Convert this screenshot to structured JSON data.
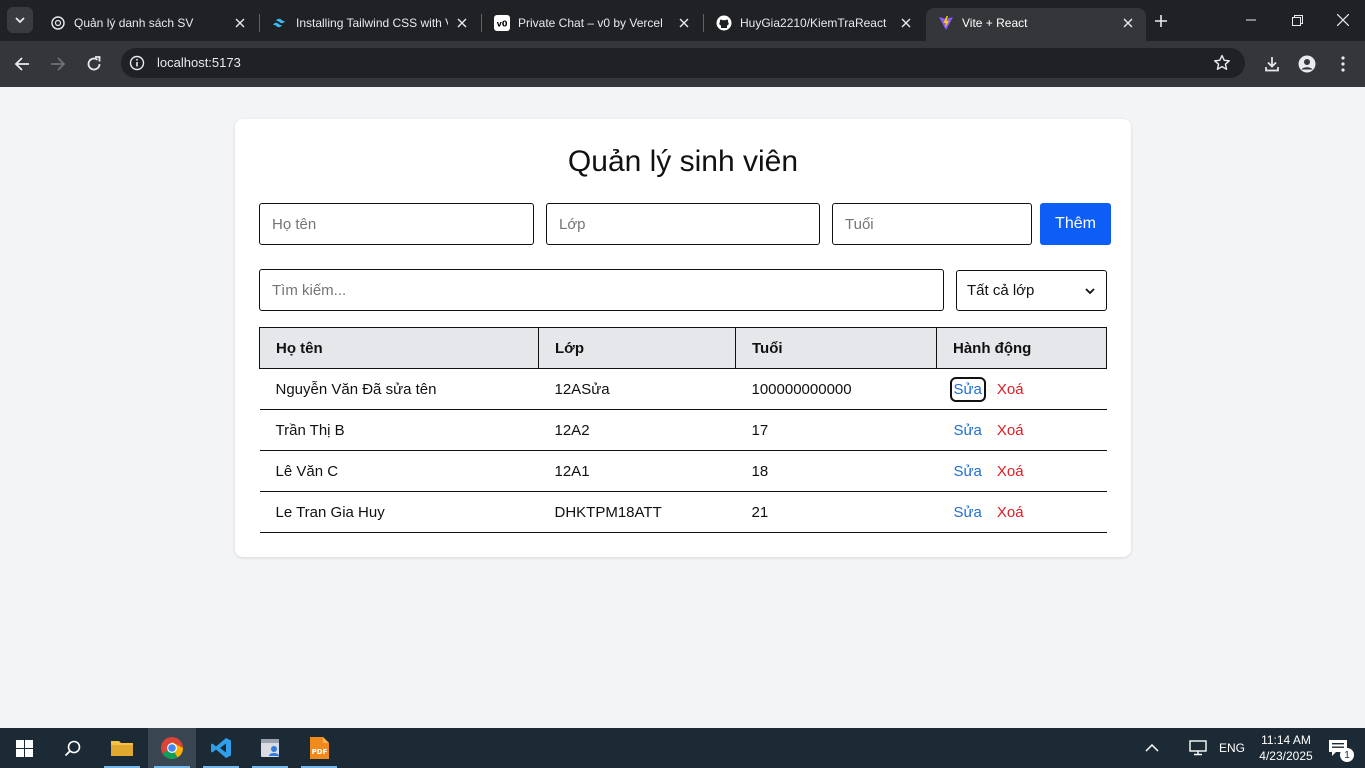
{
  "browser": {
    "tabs": [
      {
        "title": "Quản lý danh sách SV",
        "favicon": "openai-icon",
        "active": false
      },
      {
        "title": "Installing Tailwind CSS with V",
        "favicon": "tailwind-icon",
        "active": false
      },
      {
        "title": "Private Chat – v0 by Vercel",
        "favicon": "v0-icon",
        "active": false
      },
      {
        "title": "HuyGia2210/KiemTraReact",
        "favicon": "github-icon",
        "active": false
      },
      {
        "title": "Vite + React",
        "favicon": "vite-icon",
        "active": true
      }
    ],
    "url": "localhost:5173"
  },
  "page": {
    "title": "Quản lý sinh viên",
    "form": {
      "name_placeholder": "Họ tên",
      "class_placeholder": "Lớp",
      "age_placeholder": "Tuổi",
      "add_label": "Thêm"
    },
    "search": {
      "placeholder": "Tìm kiếm...",
      "filter_selected": "Tất cả lớp"
    },
    "table": {
      "headers": [
        "Họ tên",
        "Lớp",
        "Tuổi",
        "Hành động"
      ],
      "rows": [
        {
          "name": "Nguyễn Văn Đã sửa tên",
          "class": "12ASửa",
          "age": "100000000000"
        },
        {
          "name": "Trần Thị B",
          "class": "12A2",
          "age": "17"
        },
        {
          "name": "Lê Văn C",
          "class": "12A1",
          "age": "18"
        },
        {
          "name": "Le Tran Gia Huy",
          "class": "DHKTPM18ATT",
          "age": "21"
        }
      ],
      "edit_label": "Sửa",
      "delete_label": "Xoá"
    },
    "colors": {
      "primary": "#0d5ef7",
      "edit": "#1d6fd1",
      "delete": "#e01b24",
      "background": "#f3f4f6"
    }
  },
  "taskbar": {
    "language": "ENG",
    "time": "11:14 AM",
    "date": "4/23/2025",
    "notification_count": "1"
  }
}
